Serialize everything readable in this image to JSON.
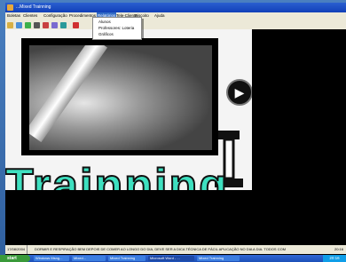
{
  "window": {
    "title": "...Mixed Trainning"
  },
  "menu": {
    "items": [
      "Boletas",
      "Clientes",
      "Configuração",
      "Procedimentos",
      "Relatórios",
      "Tele-Cliente",
      "Biscoito",
      "Ajuda"
    ],
    "highlighted": "Relatórios",
    "dropdown": [
      "Alunos",
      "Professores: Loteria",
      "Gráficos"
    ]
  },
  "toolbar": {
    "icons": [
      "new-icon",
      "open-icon",
      "save-icon",
      "cut-icon",
      "print-icon",
      "calculator-icon",
      "help-icon",
      "exit-icon"
    ]
  },
  "brand": {
    "text": "Trainning"
  },
  "status": {
    "date": "17/08/2004",
    "message": "DORMIR E RESPIRAÇÃO BEM DEPOIS DE COMER AO LONGO DO DIA, DEVE SER A DICA TÉCNICA DE FÁCIL APLICAÇÃO NO DIA A DIA. TODOS COM",
    "time": "20:16"
  },
  "taskbar": {
    "start_label": "start",
    "tasks": [
      "Windows Msng...",
      "Mixed...",
      "Mixed Trainning",
      "Microsoft Word - ...",
      "Mixed Trainning"
    ],
    "clock": "20:16"
  }
}
